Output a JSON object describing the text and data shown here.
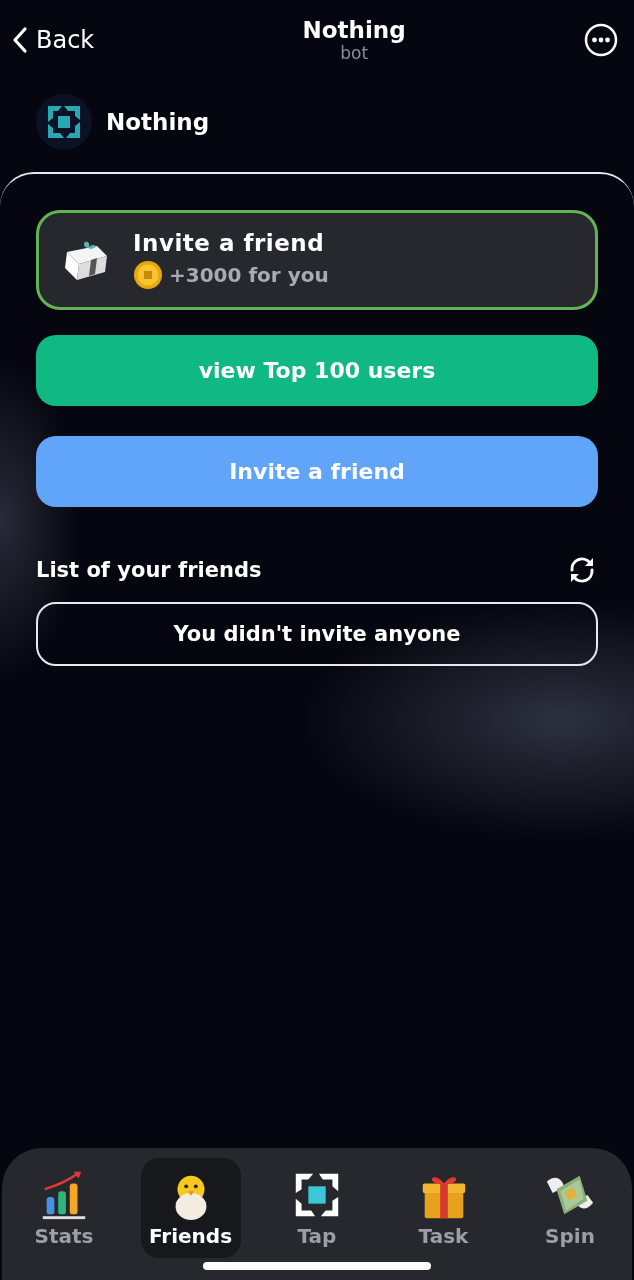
{
  "header": {
    "back": "Back",
    "title": "Nothing",
    "subtitle": "bot"
  },
  "bot": {
    "name": "Nothing"
  },
  "reward_card": {
    "title": "Invite a friend",
    "reward": "+3000 for you"
  },
  "buttons": [
    {
      "label": "view Top 100 users",
      "kind": "green"
    },
    {
      "label": "Invite a friend",
      "kind": "blue"
    }
  ],
  "friends": {
    "heading": "List of your friends",
    "empty": "You didn't invite anyone"
  },
  "nav": [
    {
      "label": "Stats",
      "kind": "stats",
      "selected": false
    },
    {
      "label": "Friends",
      "kind": "friends",
      "selected": true
    },
    {
      "label": "Tap",
      "kind": "tap",
      "selected": false
    },
    {
      "label": "Task",
      "kind": "task",
      "selected": false
    },
    {
      "label": "Spin",
      "kind": "spin",
      "selected": false
    }
  ]
}
